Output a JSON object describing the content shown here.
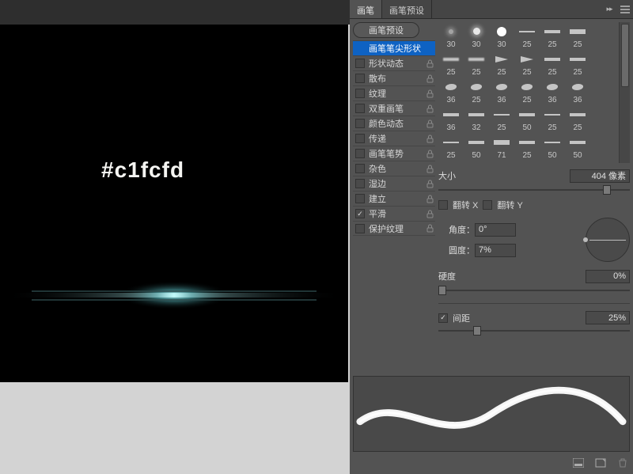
{
  "tabs": {
    "brush": "画笔",
    "presets": "画笔预设"
  },
  "preset_button": "画笔预设",
  "options": [
    {
      "label": "画笔笔尖形状",
      "no_checkbox": true,
      "selected": true
    },
    {
      "label": "形状动态",
      "locked": true
    },
    {
      "label": "散布",
      "locked": true
    },
    {
      "label": "纹理",
      "locked": true
    },
    {
      "label": "双重画笔",
      "locked": true
    },
    {
      "label": "颜色动态",
      "locked": true
    },
    {
      "label": "传递",
      "locked": true
    },
    {
      "label": "画笔笔势",
      "locked": true
    },
    {
      "label": "杂色",
      "locked": true
    },
    {
      "label": "湿边",
      "locked": true
    },
    {
      "label": "建立",
      "locked": true
    },
    {
      "label": "平滑",
      "locked": true,
      "checked": true
    },
    {
      "label": "保护纹理",
      "locked": true
    }
  ],
  "size": {
    "label": "大小",
    "value": "404 像素"
  },
  "flip": {
    "x": "翻转 X",
    "y": "翻转 Y"
  },
  "angle": {
    "label": "角度：",
    "value": "0°"
  },
  "roundness": {
    "label": "圆度：",
    "value": "7%"
  },
  "hardness": {
    "label": "硬度",
    "value": "0%"
  },
  "spacing": {
    "label": "间距",
    "value": "25%",
    "checked": true
  },
  "canvas": {
    "hex": "#c1fcfd"
  },
  "thumbs": [
    {
      "n": "30",
      "s": "dot1"
    },
    {
      "n": "30",
      "s": "dot2"
    },
    {
      "n": "30",
      "s": "dot3"
    },
    {
      "n": "25",
      "s": "bar th1"
    },
    {
      "n": "25",
      "s": "bar"
    },
    {
      "n": "25",
      "s": "bar th2"
    },
    {
      "n": "25",
      "s": "bar soft"
    },
    {
      "n": "25",
      "s": "bar soft"
    },
    {
      "n": "25",
      "s": "cone"
    },
    {
      "n": "25",
      "s": "cone"
    },
    {
      "n": "25",
      "s": "bar"
    },
    {
      "n": "25",
      "s": "bar"
    },
    {
      "n": "36",
      "s": "drop"
    },
    {
      "n": "25",
      "s": "drop"
    },
    {
      "n": "36",
      "s": "drop"
    },
    {
      "n": "25",
      "s": "drop"
    },
    {
      "n": "36",
      "s": "drop"
    },
    {
      "n": "36",
      "s": "drop"
    },
    {
      "n": "36",
      "s": "bar"
    },
    {
      "n": "32",
      "s": "bar"
    },
    {
      "n": "25",
      "s": "bar th1"
    },
    {
      "n": "50",
      "s": "bar"
    },
    {
      "n": "25",
      "s": "bar th1"
    },
    {
      "n": "25",
      "s": "bar"
    },
    {
      "n": "25",
      "s": "bar th1"
    },
    {
      "n": "50",
      "s": "bar"
    },
    {
      "n": "71",
      "s": "bar th2"
    },
    {
      "n": "25",
      "s": "bar"
    },
    {
      "n": "50",
      "s": "bar th1"
    },
    {
      "n": "50",
      "s": "bar"
    }
  ]
}
